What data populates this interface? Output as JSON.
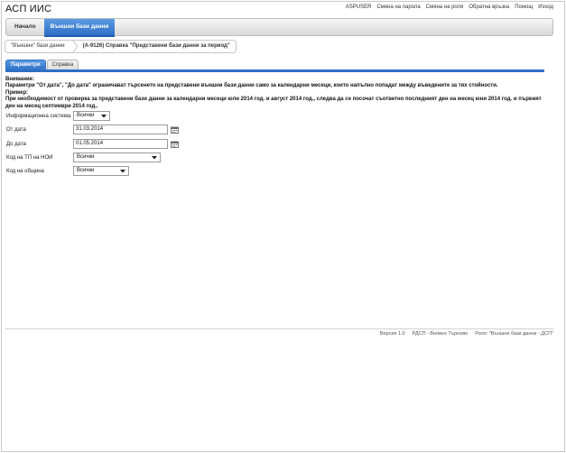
{
  "app": {
    "title": "АСП ИИС"
  },
  "topnav": [
    "ASPUSER",
    "Смяна на парола",
    "Смяна на роля",
    "Обратна връзка",
    "Помощ",
    "Изход"
  ],
  "menu": {
    "home": "Начало",
    "external_db": "Външни бази данни"
  },
  "breadcrumb": {
    "first": "\"Външни\" бази данни",
    "current": "(А-9126) Справка \"Представени бази данни за период\""
  },
  "tabs": {
    "params": "Параметри",
    "report": "Справка"
  },
  "notice": {
    "heading": "Внимание:",
    "text": "Параметри \"От дата\", \"До дата\" ограничават търсенето на представени външни бази данни само за календарни месеци, които напълно попадат между въведените за тях стойности.",
    "example_heading": "Пример:",
    "example_text": "При необходимост от проверка за представени бази данни за календарни месеци юли 2014 год. и август 2014 год., следва да се посочат съответно последният ден на месец юни 2014 год. и първият ден на месец септември 2014 год.."
  },
  "form": {
    "info_system": {
      "label": "Информационна система",
      "value": "Всички"
    },
    "from_date": {
      "label": "От дата",
      "value": "31.03.2014"
    },
    "to_date": {
      "label": "До дата",
      "value": "01.05.2014"
    },
    "tp_noi": {
      "label": "Код на ТП на НОИ",
      "value": "Всички"
    },
    "municipality": {
      "label": "Код на община",
      "value": "Всички"
    }
  },
  "footer": {
    "version": "Версия 1.0",
    "office": "РДСП - Велико Търново",
    "role": "Роля: \"Външни бази данни - ДСП\""
  },
  "colors": {
    "accent": "#2f6fc6",
    "accent_light": "#5b9be0"
  }
}
